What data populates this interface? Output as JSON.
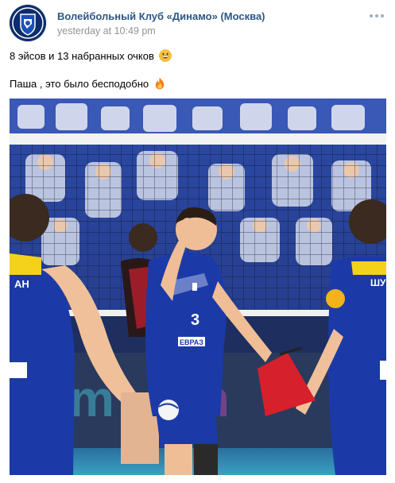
{
  "post": {
    "author": "Волейбольный Клуб «Динамо» (Москва)",
    "time": "yesterday at 10:49 pm",
    "more_icon": "ellipsis-icon",
    "text_line_1": "8 эйсов и 13 набранных очков",
    "text_line_1_emoji": "grinning-face-emoji",
    "text_line_2": "Паша , это было бесподобно",
    "text_line_2_emoji": "fire-emoji"
  },
  "photo": {
    "jersey_number": "3",
    "sponsor_label": "ЕВРАЗ"
  },
  "colors": {
    "link": "#2a5885",
    "muted": "#939393",
    "dynamo_blue": "#1b3aa8"
  }
}
